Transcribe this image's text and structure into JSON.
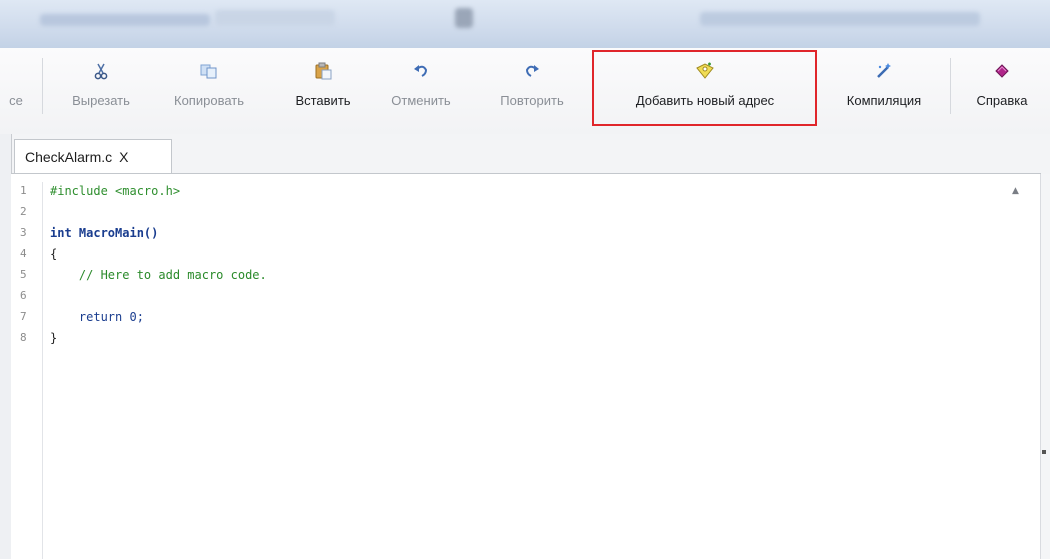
{
  "toolbar": {
    "partial_label": "ce",
    "cut_label": "Вырезать",
    "copy_label": "Копировать",
    "paste_label": "Вставить",
    "undo_label": "Отменить",
    "redo_label": "Повторить",
    "add_address_label": "Добавить новый адрес",
    "compile_label": "Компиляция",
    "help_label": "Справка"
  },
  "tab": {
    "title": "CheckAlarm.c",
    "close": "X"
  },
  "editor": {
    "line_numbers": [
      "1",
      "2",
      "3",
      "4",
      "5",
      "6",
      "7",
      "8"
    ],
    "code_lines": [
      "#include <macro.h>",
      "",
      "int MacroMain()",
      "{",
      "    // Here to add macro code.",
      "",
      "    return 0;",
      "}"
    ],
    "scroll_up_glyph": "▲"
  },
  "colors": {
    "highlight_border": "#e0262b",
    "keyword": "#1a3d8f",
    "comment": "#2a8a2a",
    "include": "#2f8f2f"
  }
}
